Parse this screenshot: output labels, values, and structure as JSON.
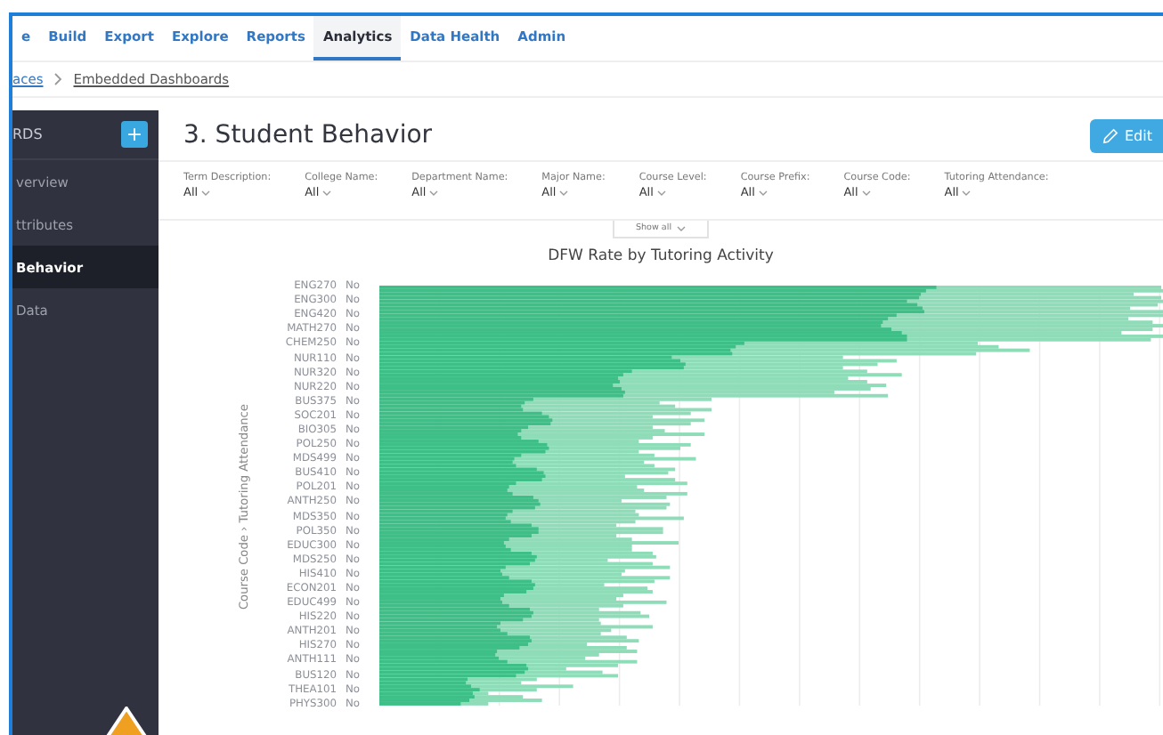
{
  "nav": {
    "tabs": [
      {
        "label": "e",
        "selected": false
      },
      {
        "label": "Build",
        "selected": false
      },
      {
        "label": "Export",
        "selected": false
      },
      {
        "label": "Explore",
        "selected": false
      },
      {
        "label": "Reports",
        "selected": false
      },
      {
        "label": "Analytics",
        "selected": true
      },
      {
        "label": "Data Health",
        "selected": false
      },
      {
        "label": "Admin",
        "selected": false
      }
    ]
  },
  "breadcrumb": [
    {
      "label": "aces"
    },
    {
      "label": "Embedded Dashboards"
    }
  ],
  "sidebar": {
    "title": "RDS",
    "add_button": "+",
    "items": [
      {
        "label": "verview",
        "selected": false
      },
      {
        "label": "ttributes",
        "selected": false
      },
      {
        "label": "Behavior",
        "selected": true
      },
      {
        "label": "Data",
        "selected": false
      }
    ]
  },
  "main": {
    "title": "3. Student Behavior",
    "edit_button": "Edit",
    "filters": [
      {
        "label": "Term Description:",
        "value": "All"
      },
      {
        "label": "College Name:",
        "value": "All"
      },
      {
        "label": "Department Name:",
        "value": "All"
      },
      {
        "label": "Major Name:",
        "value": "All"
      },
      {
        "label": "Course Level:",
        "value": "All"
      },
      {
        "label": "Course Prefix:",
        "value": "All"
      },
      {
        "label": "Course Code:",
        "value": "All"
      },
      {
        "label": "Tutoring Attendance:",
        "value": "All"
      }
    ],
    "show_all": "Show all",
    "chart": {
      "title": "DFW Rate by Tutoring Activity",
      "y_axis_title": "Course Code › Tutoring Attendance",
      "rows": [
        {
          "course": "ENG270",
          "attendance": "No"
        },
        {
          "course": "ENG300",
          "attendance": "No"
        },
        {
          "course": "ENG420",
          "attendance": "No"
        },
        {
          "course": "MATH270",
          "attendance": "No"
        },
        {
          "course": "CHEM250",
          "attendance": "No"
        },
        {
          "course": "NUR110",
          "attendance": "No"
        },
        {
          "course": "NUR320",
          "attendance": "No"
        },
        {
          "course": "NUR220",
          "attendance": "No"
        },
        {
          "course": "BUS375",
          "attendance": "No"
        },
        {
          "course": "SOC201",
          "attendance": "No"
        },
        {
          "course": "BIO305",
          "attendance": "No"
        },
        {
          "course": "POL250",
          "attendance": "No"
        },
        {
          "course": "MDS499",
          "attendance": "No"
        },
        {
          "course": "BUS410",
          "attendance": "No"
        },
        {
          "course": "POL201",
          "attendance": "No"
        },
        {
          "course": "ANTH250",
          "attendance": "No"
        },
        {
          "course": "MDS350",
          "attendance": "No"
        },
        {
          "course": "POL350",
          "attendance": "No"
        },
        {
          "course": "EDUC300",
          "attendance": "No"
        },
        {
          "course": "MDS250",
          "attendance": "No"
        },
        {
          "course": "HIS410",
          "attendance": "No"
        },
        {
          "course": "ECON201",
          "attendance": "No"
        },
        {
          "course": "EDUC499",
          "attendance": "No"
        },
        {
          "course": "HIS220",
          "attendance": "No"
        },
        {
          "course": "ANTH201",
          "attendance": "No"
        },
        {
          "course": "HIS270",
          "attendance": "No"
        },
        {
          "course": "ANTH111",
          "attendance": "No"
        },
        {
          "course": "BUS120",
          "attendance": "No"
        },
        {
          "course": "THEA101",
          "attendance": "No"
        },
        {
          "course": "PHYS300",
          "attendance": "No"
        }
      ]
    }
  }
}
